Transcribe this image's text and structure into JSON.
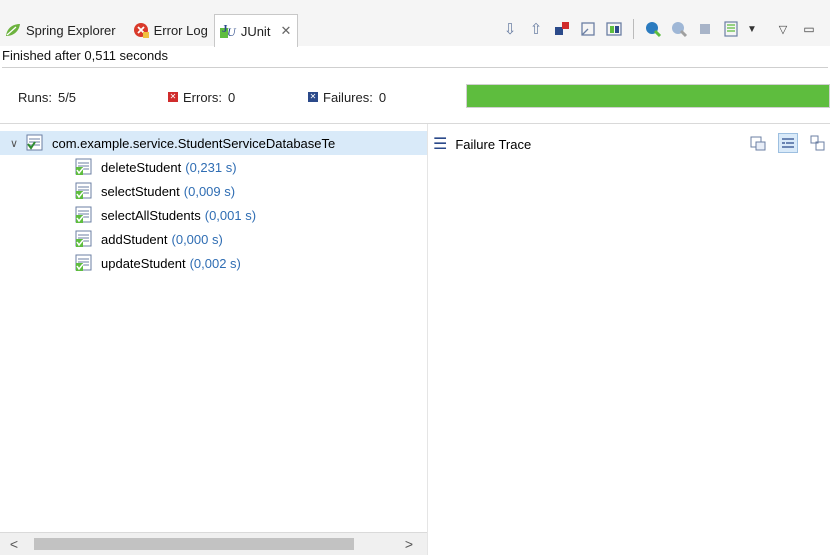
{
  "tabs": [
    {
      "label": "Spring Explorer",
      "icon": "spring-leaf-icon"
    },
    {
      "label": "Error Log",
      "icon": "error-log-icon"
    },
    {
      "label": "JUnit",
      "icon": "junit-icon",
      "close": "✕"
    }
  ],
  "status": {
    "finished": "Finished after 0,511 seconds"
  },
  "counters": {
    "runs_label": "Runs:",
    "runs_value": "5/5",
    "errors_label": "Errors:",
    "errors_value": "0",
    "failures_label": "Failures:",
    "failures_value": "0"
  },
  "progress": {
    "fraction": 1.0,
    "color": "#5ebd3e"
  },
  "tree": {
    "root": "com.example.service.StudentServiceDatabaseTe",
    "tests": [
      {
        "name": "deleteStudent",
        "time": "(0,231 s)"
      },
      {
        "name": "selectStudent",
        "time": "(0,009 s)"
      },
      {
        "name": "selectAllStudents",
        "time": "(0,001 s)"
      },
      {
        "name": "addStudent",
        "time": "(0,000 s)"
      },
      {
        "name": "updateStudent",
        "time": "(0,002 s)"
      }
    ]
  },
  "trace": {
    "title": "Failure Trace"
  },
  "scroll": {
    "left": "<",
    "right": ">"
  },
  "colors": {
    "accent": "#2f6db3",
    "selected_row": "#d9eaf9",
    "error": "#d02c2c",
    "failure": "#2b4a8a"
  }
}
